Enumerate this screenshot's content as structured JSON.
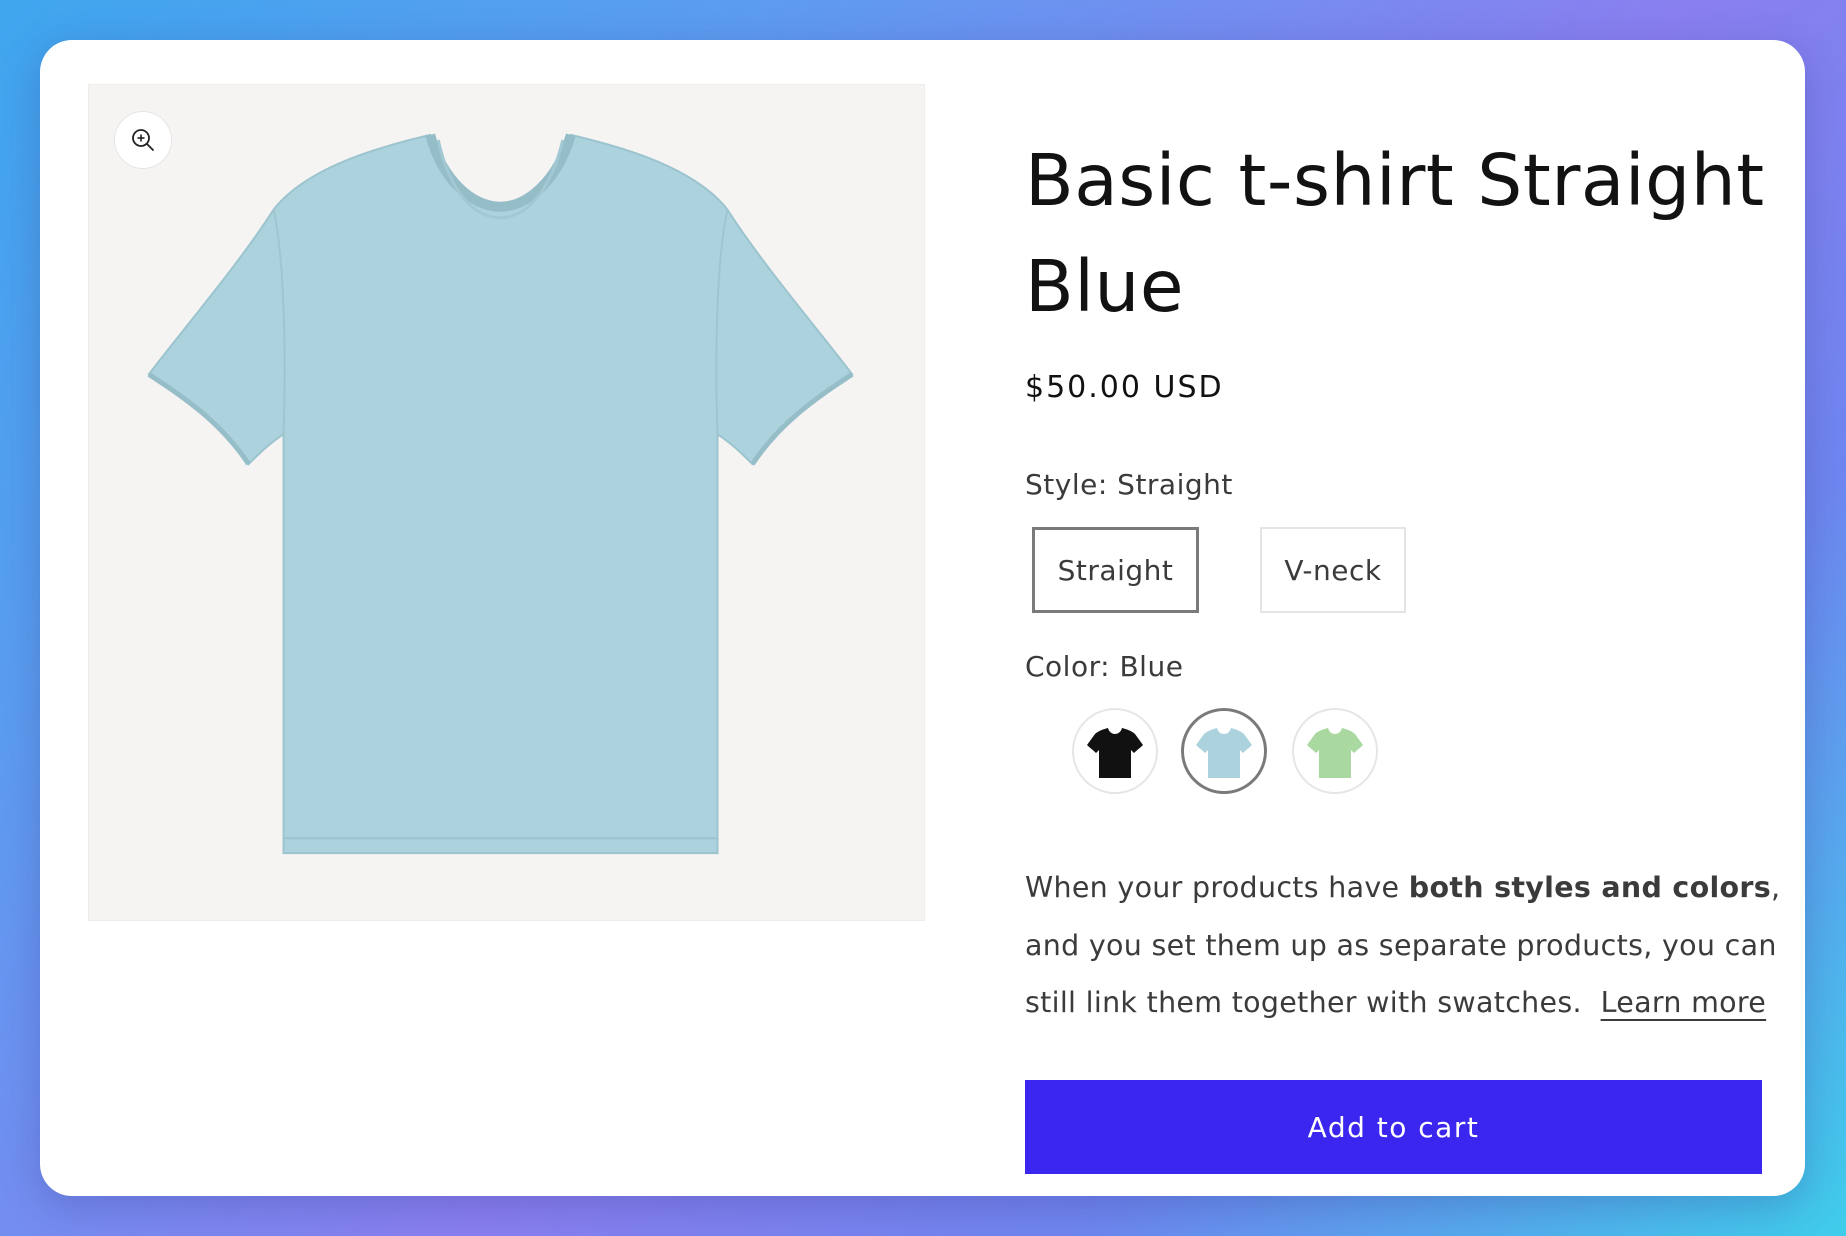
{
  "product": {
    "title": "Basic t-shirt Straight Blue",
    "price": "$50.00 USD",
    "media": {
      "zoom_icon": "zoom-in-icon",
      "image": "light blue t-shirt"
    },
    "style_option": {
      "label": "Style:",
      "selected_value": "Straight",
      "values": [
        "Straight",
        "V-neck"
      ]
    },
    "color_option": {
      "label": "Color:",
      "selected_value": "Blue",
      "swatches": [
        {
          "name": "black",
          "color": "#111111"
        },
        {
          "name": "blue",
          "color": "#acd3dd"
        },
        {
          "name": "green",
          "color": "#a9d9a0"
        }
      ]
    },
    "description": {
      "part1": "When your products have ",
      "bold": "both styles and colors",
      "part2": ", and you set them up as separate products, you can still link them together with swatches.",
      "link_label": "Learn more"
    },
    "add_to_cart_label": "Add to cart"
  },
  "colors": {
    "accent": "#3b26ef",
    "shirt": "#acd3dd"
  }
}
